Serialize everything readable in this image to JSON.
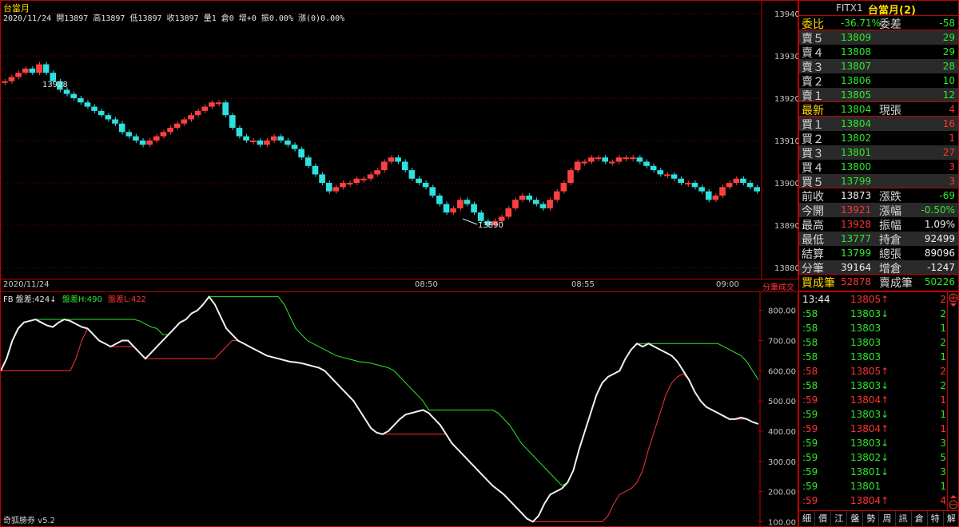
{
  "upper": {
    "title": "台當月",
    "ohlc": "2020/11/24 開13897 高13897 低13897 收13897 量1 倉0 增+0 振0.00% 漲(0)0.00%",
    "high_label": "13928",
    "low_label": "13890",
    "date_label": "2020/11/24",
    "yaxis": [
      "13940",
      "13930",
      "13920",
      "13910",
      "13900",
      "13890",
      "13880"
    ]
  },
  "time_axis": {
    "date": "2020/11/24",
    "t1": "08:50",
    "t2": "08:55",
    "t3": "09:00",
    "corner": "分筆成交"
  },
  "lower": {
    "legend_prefix": "FB 盤差:424↓",
    "legend_h": "盤差H:490",
    "legend_l": "盤差L:422",
    "footer": "奇狐勝券 v5.2",
    "yaxis": [
      "800.00",
      "700.00",
      "600.00",
      "500.00",
      "400.00",
      "300.00",
      "200.00",
      "100.00"
    ]
  },
  "quote": {
    "symbol": "FITX1",
    "name": "台當月(2)",
    "rows": [
      {
        "l1": "委比",
        "v1": "-36.71%",
        "c1": "green",
        "l2": "委差",
        "v2": "-58",
        "c2": "green"
      },
      {
        "l1": "賣５",
        "v1": "13809",
        "c1": "green",
        "l2": "",
        "v2": "29",
        "c2": "green"
      },
      {
        "l1": "賣４",
        "v1": "13808",
        "c1": "green",
        "l2": "",
        "v2": "29",
        "c2": "green"
      },
      {
        "l1": "賣３",
        "v1": "13807",
        "c1": "green",
        "l2": "",
        "v2": "28",
        "c2": "green"
      },
      {
        "l1": "賣２",
        "v1": "13806",
        "c1": "green",
        "l2": "",
        "v2": "10",
        "c2": "green"
      },
      {
        "l1": "賣１",
        "v1": "13805",
        "c1": "green",
        "l2": "",
        "v2": "12",
        "c2": "green"
      },
      {
        "l1": "最新",
        "v1": "13804",
        "c1": "green",
        "l2": "現張",
        "v2": "4",
        "c2": "red"
      },
      {
        "l1": "買１",
        "v1": "13804",
        "c1": "green",
        "l2": "",
        "v2": "16",
        "c2": "red"
      },
      {
        "l1": "買２",
        "v1": "13802",
        "c1": "green",
        "l2": "",
        "v2": "1",
        "c2": "red"
      },
      {
        "l1": "買３",
        "v1": "13801",
        "c1": "green",
        "l2": "",
        "v2": "27",
        "c2": "red"
      },
      {
        "l1": "買４",
        "v1": "13800",
        "c1": "green",
        "l2": "",
        "v2": "3",
        "c2": "red"
      },
      {
        "l1": "買５",
        "v1": "13799",
        "c1": "green",
        "l2": "",
        "v2": "3",
        "c2": "red"
      },
      {
        "l1": "前收",
        "v1": "13873",
        "c1": "white",
        "l2": "漲跌",
        "v2": "-69",
        "c2": "green"
      },
      {
        "l1": "今開",
        "v1": "13921",
        "c1": "red",
        "l2": "漲幅",
        "v2": "-0.50%",
        "c2": "green"
      },
      {
        "l1": "最高",
        "v1": "13928",
        "c1": "red",
        "l2": "振幅",
        "v2": "1.09%",
        "c2": "white"
      },
      {
        "l1": "最低",
        "v1": "13777",
        "c1": "green",
        "l2": "持倉",
        "v2": "92499",
        "c2": "white"
      },
      {
        "l1": "結算",
        "v1": "13799",
        "c1": "green",
        "l2": "總張",
        "v2": "89096",
        "c2": "white"
      },
      {
        "l1": "分筆",
        "v1": "39164",
        "c1": "white",
        "l2": "增倉",
        "v2": "-1247",
        "c2": "white"
      },
      {
        "l1": "買成筆",
        "v1": "52878",
        "c1": "red",
        "l2": "賣成筆",
        "v2": "50226",
        "c2": "green"
      }
    ]
  },
  "ticks": [
    {
      "t": "13:44",
      "p": "13805↑",
      "pc": "red",
      "v": "2",
      "vc": "red"
    },
    {
      "t": ":58",
      "p": "13803↓",
      "pc": "green",
      "v": "2",
      "vc": "green"
    },
    {
      "t": ":58",
      "p": "13803",
      "pc": "green",
      "v": "1",
      "vc": "green"
    },
    {
      "t": ":58",
      "p": "13803",
      "pc": "green",
      "v": "2",
      "vc": "green"
    },
    {
      "t": ":58",
      "p": "13803",
      "pc": "green",
      "v": "1",
      "vc": "green"
    },
    {
      "t": ":58",
      "p": "13805↑",
      "pc": "red",
      "v": "2",
      "vc": "red"
    },
    {
      "t": ":58",
      "p": "13803↓",
      "pc": "green",
      "v": "2",
      "vc": "green"
    },
    {
      "t": ":59",
      "p": "13804↑",
      "pc": "red",
      "v": "1",
      "vc": "red"
    },
    {
      "t": ":59",
      "p": "13803↓",
      "pc": "green",
      "v": "1",
      "vc": "green"
    },
    {
      "t": ":59",
      "p": "13804↑",
      "pc": "red",
      "v": "1",
      "vc": "red"
    },
    {
      "t": ":59",
      "p": "13803↓",
      "pc": "green",
      "v": "3",
      "vc": "green"
    },
    {
      "t": ":59",
      "p": "13802↓",
      "pc": "green",
      "v": "5",
      "vc": "green"
    },
    {
      "t": ":59",
      "p": "13801↓",
      "pc": "green",
      "v": "3",
      "vc": "green"
    },
    {
      "t": ":59",
      "p": "13801",
      "pc": "green",
      "v": "1",
      "vc": "green"
    },
    {
      "t": ":59",
      "p": "13804↑",
      "pc": "red",
      "v": "4",
      "vc": "red"
    }
  ],
  "tick_tabs": [
    "細",
    "價",
    "江",
    "盤",
    "勢",
    "周",
    "訊",
    "倉",
    "特",
    "解"
  ],
  "chart_data": {
    "type": "line",
    "title": "台當月",
    "upper_candles_close": [
      13924,
      13925,
      13926,
      13927,
      13926,
      13928,
      13926,
      13924,
      13922,
      13921,
      13920,
      13919,
      13918,
      13917,
      13916,
      13915,
      13914,
      13912,
      13911,
      13910,
      13909,
      13910,
      13911,
      13912,
      13913,
      13914,
      13915,
      13916,
      13917,
      13918,
      13919,
      13919,
      13916,
      13913,
      13911,
      13910,
      13910,
      13909,
      13910,
      13911,
      13910,
      13909,
      13908,
      13906,
      13904,
      13902,
      13900,
      13898,
      13899,
      13900,
      13900,
      13901,
      13901,
      13902,
      13903,
      13905,
      13906,
      13905,
      13903,
      13901,
      13900,
      13899,
      13897,
      13895,
      13893,
      13894,
      13896,
      13895,
      13893,
      13891,
      13890,
      13891,
      13892,
      13894,
      13896,
      13897,
      13896,
      13895,
      13894,
      13896,
      13898,
      13900,
      13903,
      13905,
      13905,
      13906,
      13906,
      13905,
      13905,
      13906,
      13906,
      13906,
      13905,
      13904,
      13903,
      13902,
      13902,
      13901,
      13900,
      13900,
      13899,
      13898,
      13896,
      13897,
      13899,
      13900,
      13901,
      13900,
      13899,
      13898
    ],
    "upper_ylim": [
      13877,
      13943
    ],
    "lower_series": [
      {
        "name": "FB 盤差",
        "values": [
          600,
          640,
          700,
          740,
          760,
          765,
          770,
          760,
          750,
          745,
          760,
          770,
          765,
          755,
          745,
          740,
          720,
          700,
          690,
          680,
          690,
          700,
          700,
          680,
          660,
          640,
          660,
          680,
          700,
          720,
          740,
          760,
          770,
          790,
          800,
          820,
          845,
          820,
          780,
          740,
          720,
          700,
          690,
          680,
          670,
          660,
          650,
          645,
          640,
          635,
          630,
          628,
          625,
          620,
          615,
          610,
          600,
          580,
          560,
          540,
          520,
          500,
          470,
          440,
          410,
          395,
          390,
          400,
          420,
          440,
          455,
          460,
          465,
          470,
          460,
          440,
          420,
          390,
          360,
          340,
          320,
          300,
          280,
          260,
          240,
          220,
          205,
          190,
          170,
          150,
          130,
          110,
          100,
          120,
          160,
          190,
          200,
          210,
          230,
          270,
          340,
          400,
          460,
          520,
          560,
          580,
          590,
          600,
          640,
          670,
          690,
          680,
          690,
          680,
          670,
          660,
          650,
          630,
          600,
          570,
          530,
          500,
          480,
          470,
          460,
          450,
          440,
          440,
          445,
          440,
          430,
          424
        ]
      },
      {
        "name": "盤差H",
        "values": [
          490
        ]
      },
      {
        "name": "盤差L",
        "values": [
          422
        ]
      }
    ],
    "lower_ylim": [
      80,
      860
    ]
  }
}
